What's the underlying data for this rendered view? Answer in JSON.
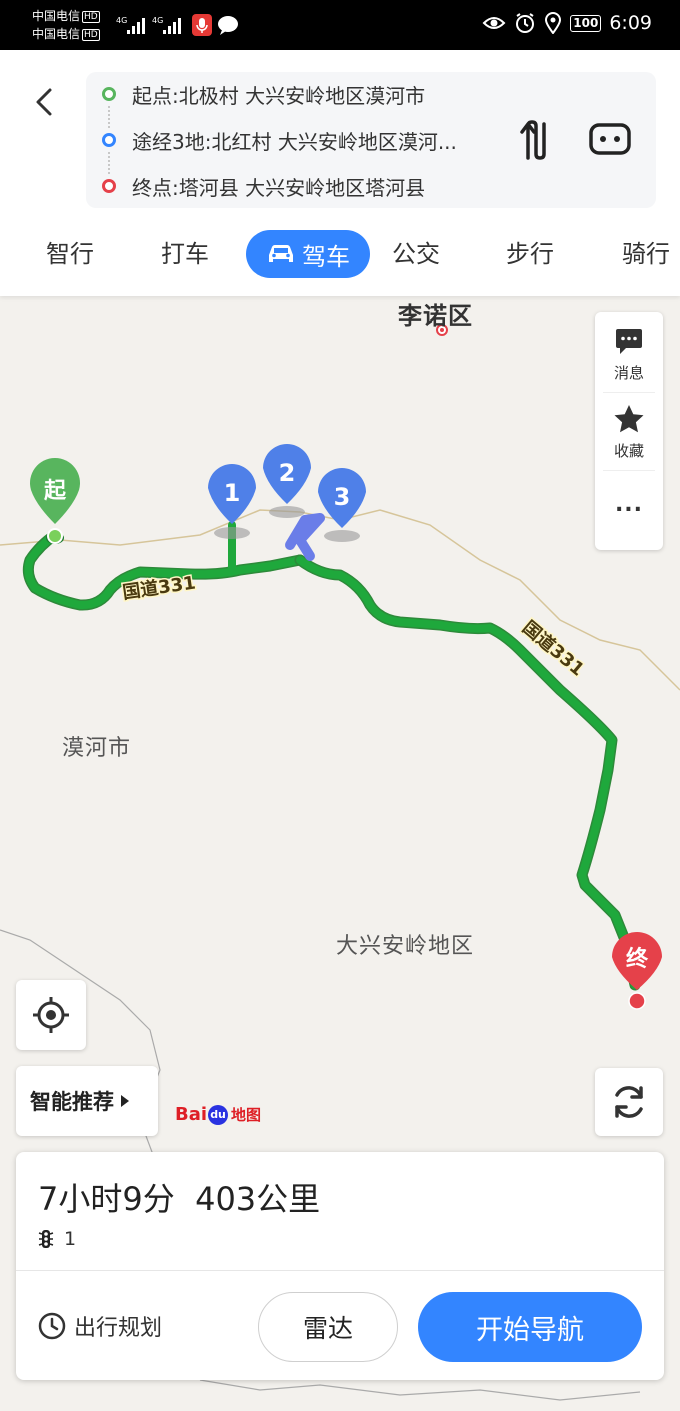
{
  "status_bar": {
    "carrier_1": "中国电信",
    "carrier_2": "中国电信",
    "hd": "HD",
    "network_1": "4G",
    "network_2": "4G",
    "battery": "100",
    "time": "6:09"
  },
  "route": {
    "start": "起点:北极村 大兴安岭地区漠河市",
    "via": "途经3地:北红村 大兴安岭地区漠河...",
    "end": "终点:塔河县 大兴安岭地区塔河县"
  },
  "tabs": [
    {
      "label": "智行",
      "active": false
    },
    {
      "label": "打车",
      "active": false
    },
    {
      "label": "驾车",
      "active": true
    },
    {
      "label": "公交",
      "active": false
    },
    {
      "label": "步行",
      "active": false
    },
    {
      "label": "骑行",
      "active": false
    }
  ],
  "map": {
    "labels": {
      "top_city": "李诺区",
      "county": "漠河市",
      "region": "大兴安岭地区"
    },
    "road_labels": [
      "国道331",
      "国道331"
    ],
    "markers": {
      "start": "起",
      "end": "终",
      "waypoints": [
        "1",
        "2",
        "3"
      ]
    },
    "route_color": "#1fa83c",
    "route_highlight_color": "#6a7de8"
  },
  "side_panel": {
    "messages": "消息",
    "favorites": "收藏",
    "more": "..."
  },
  "smart_recommend": "智能推荐",
  "baidu_logo": {
    "bai": "Bai",
    "du": "du",
    "map": "地图"
  },
  "summary": {
    "duration": "7小时9分",
    "distance": "403公里",
    "traffic_lights": "1",
    "plan": "出行规划",
    "radar": "雷达",
    "start_nav": "开始导航"
  },
  "colors": {
    "accent": "#3385ff",
    "start_green": "#58b55e",
    "end_red": "#e5414a"
  }
}
